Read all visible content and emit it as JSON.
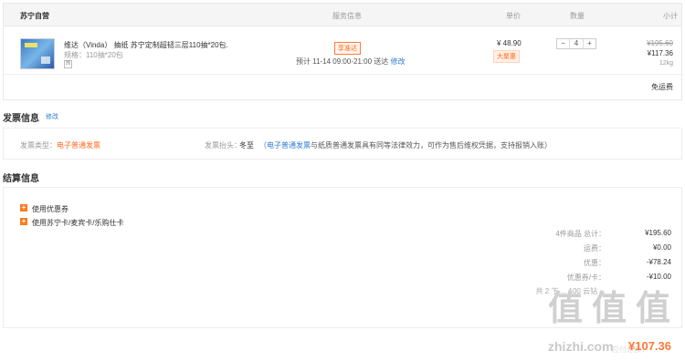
{
  "header": {
    "store": "苏宁自营",
    "service": "服务信息",
    "price": "单价",
    "qty": "数量",
    "subtotal": "小计"
  },
  "product": {
    "title": "维达（Vinda） 抽纸 苏宁定制超韧三层110抽*20包...",
    "spec": "规格：110抽*20包",
    "badge": "囤",
    "service_tag": "享准达",
    "delivery": "预计 11-14 09:00-21:00 送达",
    "delivery_edit": "修改",
    "price": "¥ 48.90",
    "price_tag": "大聚惠",
    "qty_minus": "−",
    "qty_value": "4",
    "qty_plus": "+",
    "subtotal_old": "¥195.60",
    "subtotal_new": "¥117.36",
    "weight": "12kg"
  },
  "shipping": "免运费",
  "invoice": {
    "title": "发票信息",
    "edit": "修改",
    "type_label": "发票类型：",
    "type_value": "电子普通发票",
    "head_label": "发票抬头：",
    "head_value": "冬至",
    "note_prefix": "（电子普通发票",
    "note_rest": "与纸质普通发票具有同等法律效力，可作为售后维权凭据，支持报销入账）"
  },
  "settle": {
    "title": "结算信息",
    "coupon": "使用优惠券",
    "card": "使用苏宁卡/麦宾卡/乐购仕卡",
    "summary": [
      {
        "label": "4件商品 总计：",
        "value": "¥195.60"
      },
      {
        "label": "运费：",
        "value": "¥0.00"
      },
      {
        "label": "优惠：",
        "value": "-¥78.24"
      },
      {
        "label": "优惠券/卡：",
        "value": "-¥10.00"
      }
    ],
    "partial_row": "共 2 下 ... 100 云钻 ..."
  },
  "watermark": {
    "glyph": "值",
    "url": "zhizhi.com"
  },
  "total": {
    "label": "应付总额：",
    "value": "¥107.36"
  }
}
